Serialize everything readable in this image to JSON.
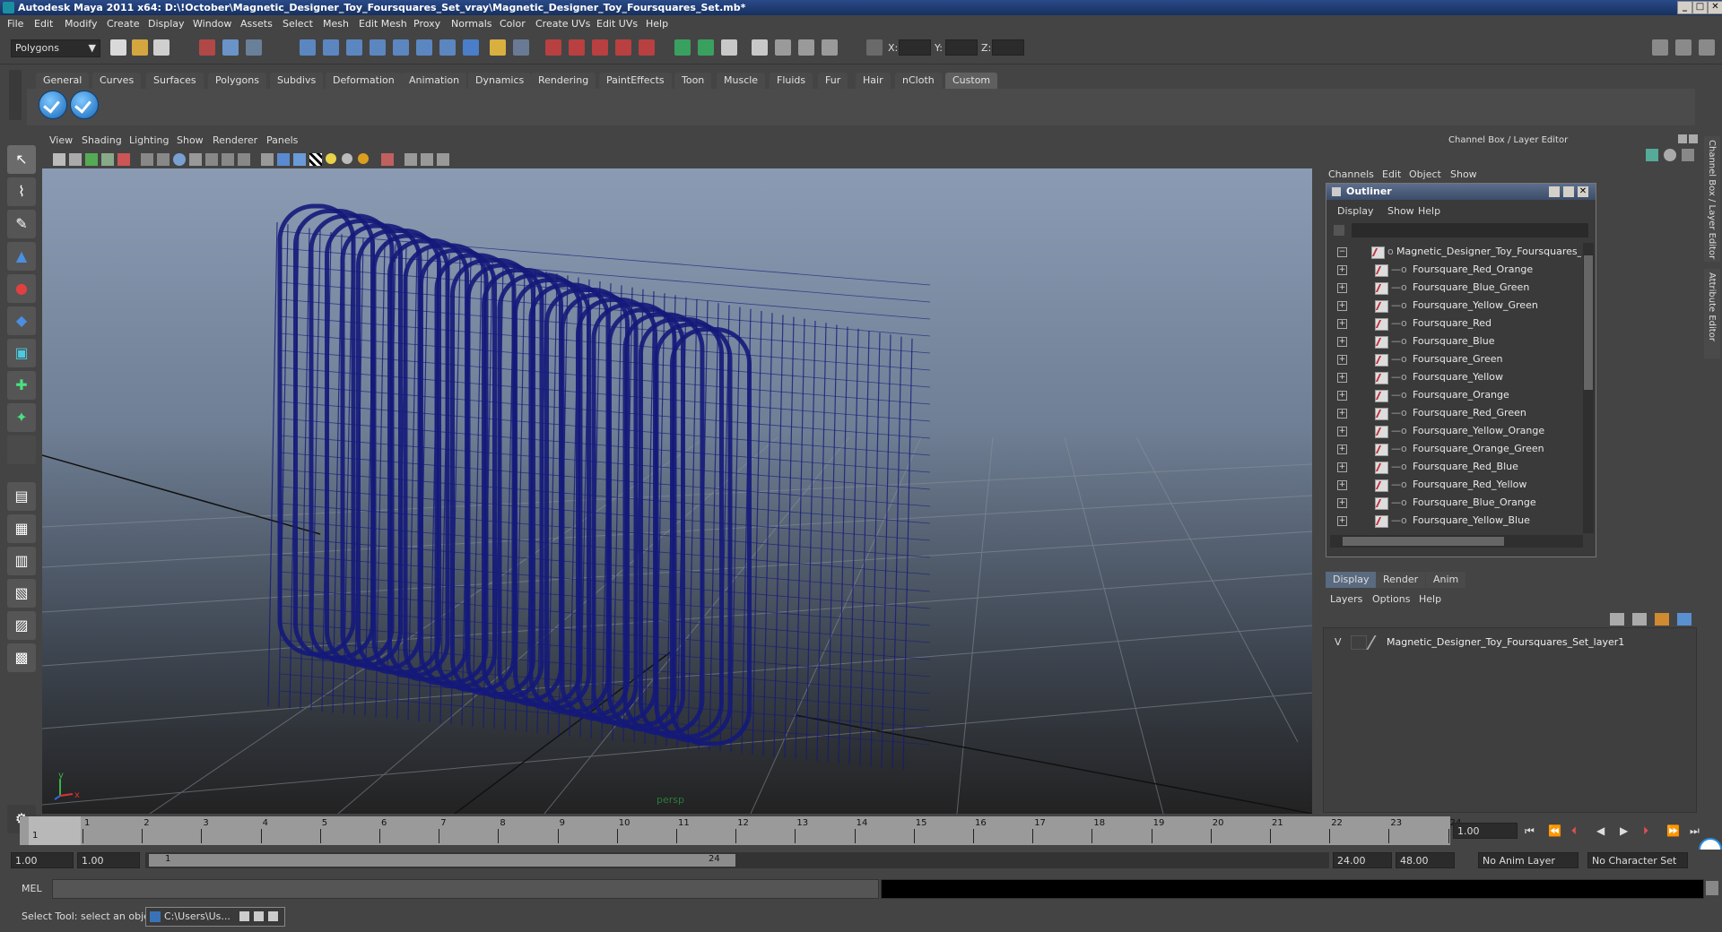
{
  "title": "Autodesk Maya 2011 x64: D:\\!October\\Magnetic_Designer_Toy_Foursquares_Set_vray\\Magnetic_Designer_Toy_Foursquares_Set.mb*",
  "window_controls": [
    "_",
    "□",
    "✕"
  ],
  "menubar": [
    "File",
    "Edit",
    "Modify",
    "Create",
    "Display",
    "Window",
    "Assets",
    "Select",
    "Mesh",
    "Edit Mesh",
    "Proxy",
    "Normals",
    "Color",
    "Create UVs",
    "Edit UVs",
    "Help"
  ],
  "status": {
    "mode_select": "Polygons",
    "x_label": "X:",
    "y_label": "Y:",
    "z_label": "Z:"
  },
  "shelf_tabs": [
    "General",
    "Curves",
    "Surfaces",
    "Polygons",
    "Subdivs",
    "Deformation",
    "Animation",
    "Dynamics",
    "Rendering",
    "PaintEffects",
    "Toon",
    "Muscle",
    "Fluids",
    "Fur",
    "Hair",
    "nCloth",
    "Custom"
  ],
  "shelf_active_tab": "Custom",
  "viewport": {
    "menu": [
      "View",
      "Shading",
      "Lighting",
      "Show",
      "Renderer",
      "Panels"
    ],
    "camera_label": "persp",
    "axis_x": "x",
    "axis_y": "y",
    "wire_color": "#141a7a"
  },
  "channel_box": {
    "header": "Channel Box / Layer Editor",
    "menu": [
      "Channels",
      "Edit",
      "Object",
      "Show"
    ],
    "side_tabs": [
      "Channel Box / Layer Editor",
      "Attribute Editor"
    ]
  },
  "outliner": {
    "title": "Outliner",
    "menu": [
      "Display",
      "Show",
      "Help"
    ],
    "root": "Magnetic_Designer_Toy_Foursquares_Set",
    "items": [
      "Foursquare_Red_Orange",
      "Foursquare_Blue_Green",
      "Foursquare_Yellow_Green",
      "Foursquare_Red",
      "Foursquare_Blue",
      "Foursquare_Green",
      "Foursquare_Yellow",
      "Foursquare_Orange",
      "Foursquare_Red_Green",
      "Foursquare_Yellow_Orange",
      "Foursquare_Orange_Green",
      "Foursquare_Red_Blue",
      "Foursquare_Red_Yellow",
      "Foursquare_Blue_Orange",
      "Foursquare_Yellow_Blue"
    ]
  },
  "layer_editor": {
    "tabs": [
      "Display",
      "Render",
      "Anim"
    ],
    "menu": [
      "Layers",
      "Options",
      "Help"
    ],
    "layer_visibility": "V",
    "layer_name": "Magnetic_Designer_Toy_Foursquares_Set_layer1"
  },
  "timeline": {
    "ticks": [
      "1",
      "2",
      "3",
      "4",
      "5",
      "6",
      "7",
      "8",
      "9",
      "10",
      "11",
      "12",
      "13",
      "14",
      "15",
      "16",
      "17",
      "18",
      "19",
      "20",
      "21",
      "22",
      "23",
      "24"
    ],
    "current_frame_marker": "1",
    "current_time": "1.00"
  },
  "range": {
    "start": "1.00",
    "playback_start": "1.00",
    "slider_start": "1",
    "slider_end": "24",
    "playback_end": "24.00",
    "end": "48.00",
    "anim_layer": "No Anim Layer",
    "character_set": "No Character Set"
  },
  "command_line": {
    "label": "MEL"
  },
  "help_line": {
    "text": "Select Tool: select an object",
    "taskbar_item": "C:\\Users\\Us..."
  }
}
